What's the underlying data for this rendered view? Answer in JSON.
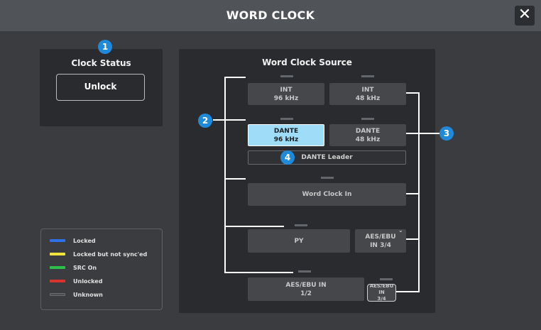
{
  "window": {
    "title": "WORD CLOCK",
    "close_icon": "✕"
  },
  "clock_status": {
    "title": "Clock Status",
    "value": "Unlock"
  },
  "word_clock_source": {
    "title": "Word Clock Source",
    "buttons": {
      "int96": {
        "line1": "INT",
        "line2": "96 kHz"
      },
      "int48": {
        "line1": "INT",
        "line2": "48 kHz"
      },
      "dante96": {
        "line1": "DANTE",
        "line2": "96 kHz"
      },
      "dante48": {
        "line1": "DANTE",
        "line2": "48 kHz"
      },
      "dante_leader": {
        "label": "DANTE Leader"
      },
      "wordclock_in": {
        "label": "Word Clock In"
      },
      "py": {
        "label": "PY"
      },
      "aes_py": {
        "line1": "AES/EBU",
        "line2": "IN 3/4"
      },
      "aes12": {
        "line1": "AES/EBU IN",
        "line2": "1/2"
      },
      "aes34": {
        "line1": "AES/EBU IN",
        "line2": "3/4"
      }
    }
  },
  "badges": [
    "1",
    "2",
    "3",
    "4"
  ],
  "legend": [
    {
      "label": "Locked",
      "color": "#2f6fe8"
    },
    {
      "label": "Locked but not sync'ed",
      "color": "#f0e43a"
    },
    {
      "label": "SRC On",
      "color": "#2cc04a"
    },
    {
      "label": "Unlocked",
      "color": "#d8342c"
    },
    {
      "label": "Unknown",
      "color": "#4a4c50"
    }
  ],
  "colors": {
    "accent": "#1f8ad9",
    "active_button": "#9fdcf8"
  }
}
